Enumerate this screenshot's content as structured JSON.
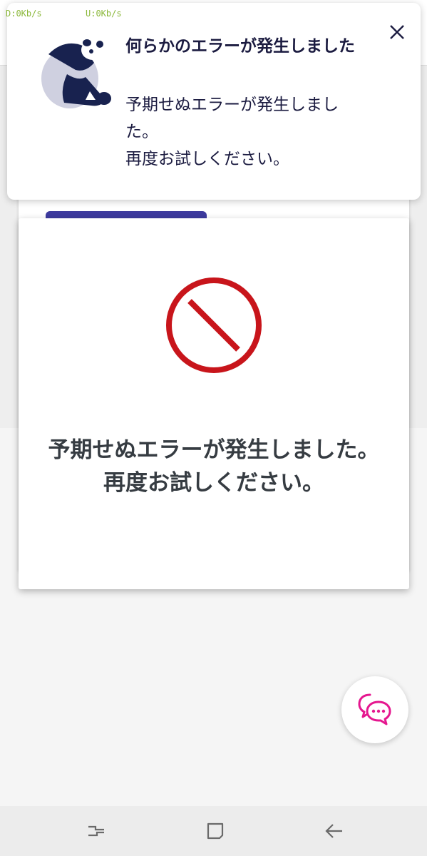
{
  "status_bar": {
    "download_speed": "D:0Kb/s",
    "upload_speed": "U:0Kb/s"
  },
  "toast": {
    "title": "何らかのエラーが発生しました",
    "message_line1": "予期せぬエラーが発生しました。",
    "message_line2": "再度お試しください。",
    "illustration": "sad-panda",
    "close_icon": "close-icon"
  },
  "dialog": {
    "icon": "prohibited-icon",
    "message_line1": "予期せぬエラーが発生しました。",
    "message_line2": "再度お試しください。"
  },
  "chat_button": {
    "icon": "chat-bubbles-icon"
  },
  "nav_bar": {
    "recent_icon": "recent-apps-icon",
    "home_icon": "home-icon",
    "back_icon": "back-icon"
  },
  "colors": {
    "accent_purple": "#3d3a9e",
    "error_red": "#c8151b",
    "chat_pink": "#e5178f",
    "toast_text": "#1b1b40",
    "dialog_text": "#363c42"
  }
}
